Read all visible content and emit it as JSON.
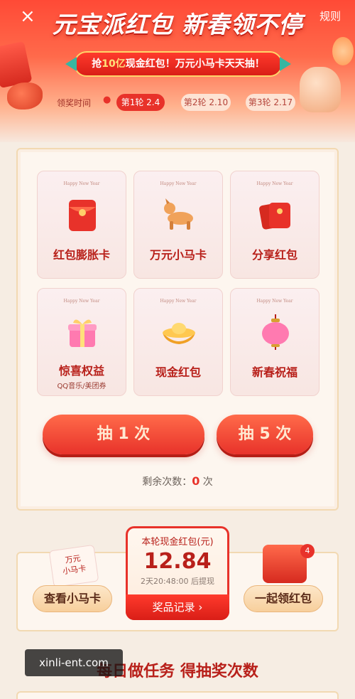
{
  "header": {
    "close_icon": "×",
    "rules_label": "规则",
    "title": "元宝派红包 新春领不停",
    "banner_prefix": "抢",
    "banner_accent": "10亿",
    "banner_suffix": "现金红包！万元小马卡天天抽！",
    "dates_label": "领奖时间",
    "rounds": [
      {
        "label": "第1轮 2.4",
        "active": true
      },
      {
        "label": "第2轮 2.10",
        "active": false
      },
      {
        "label": "第3轮 2.17",
        "active": false
      }
    ]
  },
  "tiles": [
    {
      "hny": "Happy New Year",
      "label": "红包膨胀卡",
      "sub": "",
      "icon": "red-envelope-icon"
    },
    {
      "hny": "Happy New Year",
      "label": "万元小马卡",
      "sub": "",
      "icon": "horse-icon"
    },
    {
      "hny": "Happy New Year",
      "label": "分享红包",
      "sub": "",
      "icon": "share-envelope-icon"
    },
    {
      "hny": "Happy New Year",
      "label": "惊喜权益",
      "sub": "QQ音乐/美团券",
      "icon": "gift-box-icon"
    },
    {
      "hny": "Happy New Year",
      "label": "现金红包",
      "sub": "",
      "icon": "gold-ingot-icon"
    },
    {
      "hny": "Happy New Year",
      "label": "新春祝福",
      "sub": "",
      "icon": "lantern-icon"
    }
  ],
  "draw": {
    "draw_once": "抽 1 次",
    "draw_five": "抽 5 次",
    "remaining_prefix": "剩余次数：",
    "remaining_count": "0",
    "remaining_suffix": "次"
  },
  "cash": {
    "title": "本轮现金红包(元)",
    "amount": "12.84",
    "timer": "2天20:48:00 后提现",
    "records_label": "奖品记录 ›"
  },
  "bottom": {
    "horse_card_text": "万元\n小马卡",
    "view_horse_label": "查看小马卡",
    "join_redpack_label": "一起领红包",
    "badge_count": "4"
  },
  "task_title": "每日做任务 得抽奖次数",
  "watermark": "xinli-ent.com",
  "colors": {
    "primary_red": "#e8322a",
    "accent_gold": "#ffe17a",
    "banner_teal": "#37b6a1"
  }
}
